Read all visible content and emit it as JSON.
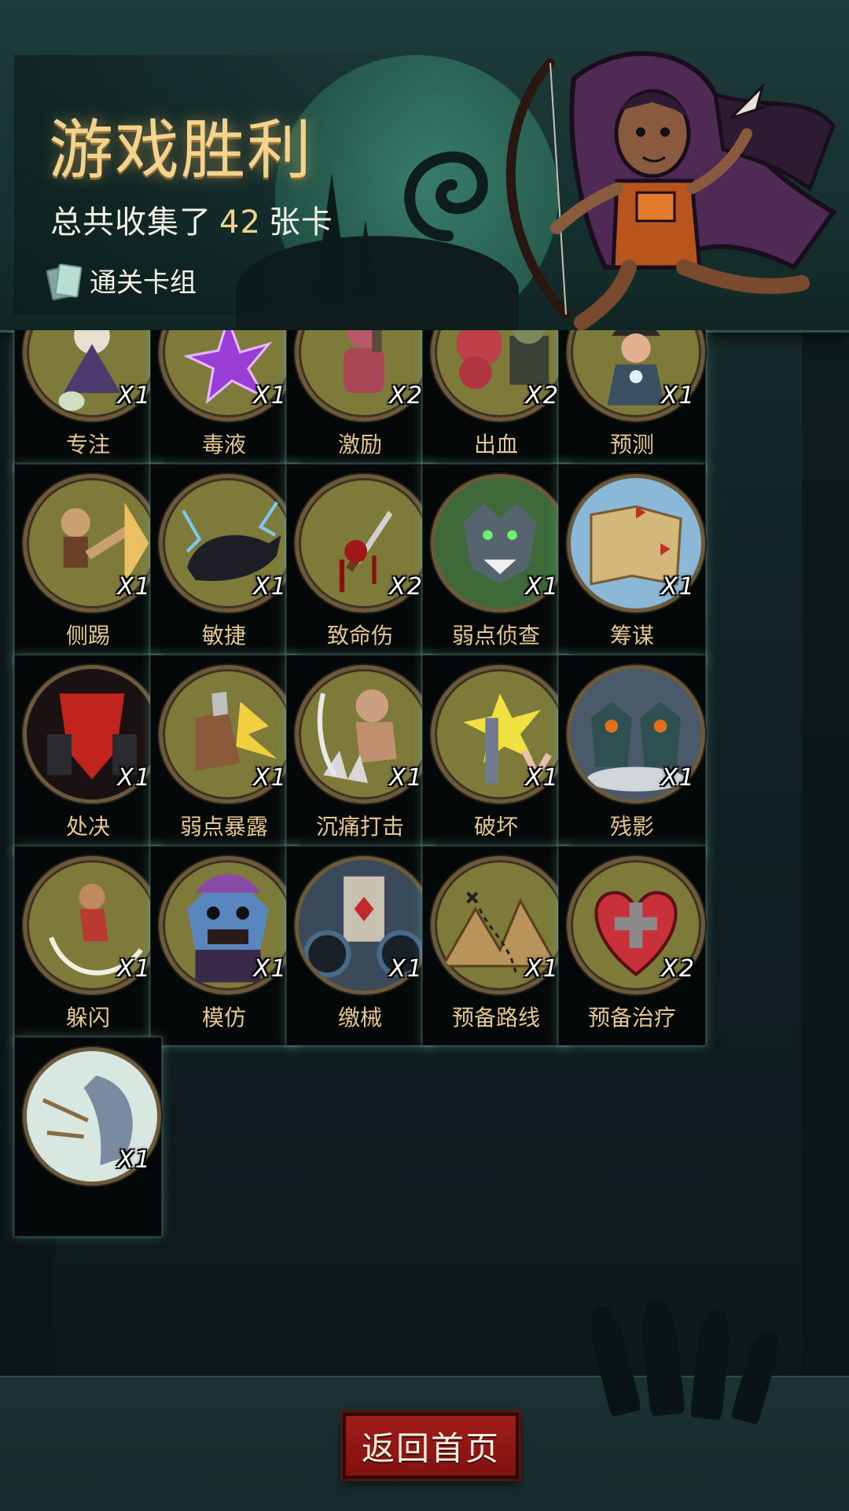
{
  "header": {
    "title": "游戏胜利",
    "summary_prefix": "总共收集了",
    "summary_count": "42",
    "summary_suffix": "张卡",
    "deck_button_label": "通关卡组"
  },
  "cards": [
    {
      "name": "专注",
      "count": "X1",
      "art": "wizard"
    },
    {
      "name": "毒液",
      "count": "X1",
      "art": "poison"
    },
    {
      "name": "激励",
      "count": "X2",
      "art": "brute"
    },
    {
      "name": "出血",
      "count": "X2",
      "art": "tentacle"
    },
    {
      "name": "预测",
      "count": "X1",
      "art": "witch"
    },
    {
      "name": "侧踢",
      "count": "X1",
      "art": "kick"
    },
    {
      "name": "敏捷",
      "count": "X1",
      "art": "panther"
    },
    {
      "name": "致命伤",
      "count": "X2",
      "art": "dagger"
    },
    {
      "name": "弱点侦查",
      "count": "X1",
      "art": "wolf"
    },
    {
      "name": "筹谋",
      "count": "X1",
      "art": "map"
    },
    {
      "name": "处决",
      "count": "X1",
      "art": "execute"
    },
    {
      "name": "弱点暴露",
      "count": "X1",
      "art": "boot"
    },
    {
      "name": "沉痛打击",
      "count": "X1",
      "art": "goblin"
    },
    {
      "name": "破坏",
      "count": "X1",
      "art": "break"
    },
    {
      "name": "残影",
      "count": "X1",
      "art": "ghosts"
    },
    {
      "name": "躲闪",
      "count": "X1",
      "art": "dodge"
    },
    {
      "name": "模仿",
      "count": "X1",
      "art": "troll"
    },
    {
      "name": "缴械",
      "count": "X1",
      "art": "gears"
    },
    {
      "name": "预备路线",
      "count": "X1",
      "art": "mountains"
    },
    {
      "name": "预备治疗",
      "count": "X2",
      "art": "heart"
    },
    {
      "name": "",
      "count": "X1",
      "art": "shield"
    }
  ],
  "footer": {
    "home_button_label": "返回首页"
  },
  "colors": {
    "title_gold": "#f3d38e",
    "card_name": "#e5c68f",
    "card_glow": "#6eb4a0",
    "button_red": "#a01c18"
  }
}
